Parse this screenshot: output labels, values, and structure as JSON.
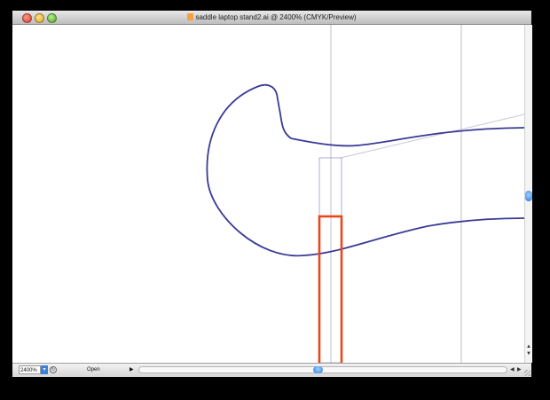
{
  "window": {
    "title": "saddle laptop stand2.ai @ 2400% (CMYK/Preview)"
  },
  "statusbar": {
    "zoom_value": "2400%",
    "status_text": "Open",
    "zoom_dropdown_icon": "chevron-down-icon",
    "status_arrow_icon": "triangle-right-icon"
  },
  "colors": {
    "path_stroke": "#3b3a96",
    "selection_box": "#e8471c",
    "guide_line": "#c8c8d4",
    "scroll_thumb": "#2f7bd8"
  },
  "scroll": {
    "vertical_position": 0.5,
    "horizontal_position": 0.47
  }
}
